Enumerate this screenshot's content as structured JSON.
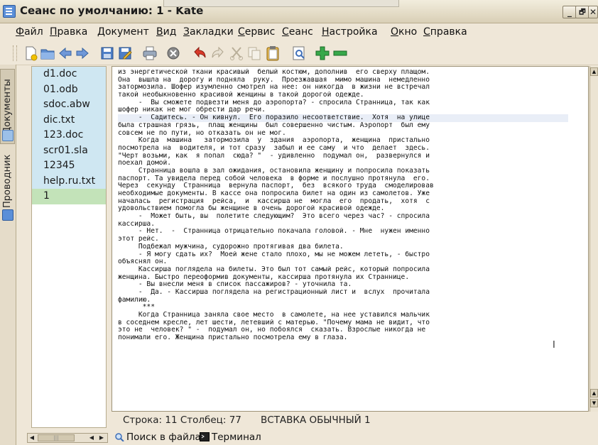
{
  "window": {
    "title": "Сеанс по умолчанию: 1 - Kate",
    "btn_min": "_",
    "btn_max": "🗗",
    "btn_close": "✕"
  },
  "menu": [
    "Файл",
    "Правка",
    "Документ",
    "Вид",
    "Закладки",
    "Сервис",
    "Сеанс",
    "Настройка",
    "Окно",
    "Справка"
  ],
  "toolbar_icons": [
    "new-document-icon",
    "open-folder-icon",
    "back-arrow-icon",
    "forward-arrow-icon",
    "save-disk-icon",
    "save-as-icon",
    "print-icon",
    "close-document-icon",
    "undo-icon",
    "redo-icon",
    "cut-icon",
    "copy-icon",
    "paste-icon",
    "find-icon",
    "zoom-in-icon",
    "zoom-out-icon"
  ],
  "side_tabs": {
    "documents": "Документы",
    "explorer": "Проводник"
  },
  "files": [
    "d1.doc",
    "01.odb",
    "sdoc.abw",
    "dic.txt",
    "123.doc",
    "scr01.sla",
    "12345",
    "help.ru.txt",
    "1"
  ],
  "editor_lines": [
    "из энергетической ткани красивый  белый костюм, дополнив  его сверху плащом.",
    "Она  вышла на  дорогу и подняла  руку.  Проезжавшая  мимо машина  немедленно",
    "затормозила. Шофер изумленно смотрел на нее: он никогда  в жизни не встречал",
    "такой необыкновенно красивой женщины в такой дорогой одежде.",
    "     -  Вы сможете подвезти меня до аэропорта? - спросила Странница, так как",
    "шофер никак не мог обрести дар речи.",
    "     -  Садитесь. - Он кивнул.  Его поразило несоответствие.  Хотя  на улице",
    "была страшная грязь,  плащ женщины  был совершенно чистым. Аэропорт  был ему",
    "совсем не по пути, но отказать он не мог.",
    "     Когда  машина   затормозила  у  здания  аэропорта,  женщина  пристально",
    "посмотрела на  водителя, и тот сразу  забыл и ее саму  и что  делает  здесь.",
    "\"Черт возьми, как  я попал  сюда? \"  - удивленно  подумал он,  развернулся и",
    "поехал домой.",
    "     Странница вошла в зал ожидания, остановила женщину и попросила показать",
    "паспорт. Та увидела перед собой человека  в форме и послушно протянула  его.",
    "Через  секунду  Странница  вернула паспорт,  без  всякого труда  смоделировав",
    "необходимые документы. В кассе она попросила билет на один из самолетов. Уже",
    "началась  регистрация  рейса,  и  кассирша не  могла  его  продать,  хотя  с",
    "удовольствием помогла бы женщине в очень дорогой красивой одежде.",
    "     -  Может быть, вы  полетите следующим?  Это всего через час? - спросила",
    "кассирша.",
    "     - Нет.  -  Странница отрицательно покачала головой. - Мне  нужен именно",
    "этот рейс.",
    "     Подбежал мужчина, судорожно протягивая два билета.",
    "     - Я могу сдать их?  Моей жене стало плохо, мы не можем лететь, - быстро",
    "объяснял он.",
    "     Кассирша поглядела на билеты. Это был тот самый рейс, который попросила",
    "женщина. Быстро переоформив документы, кассирша протянула их Страннице.",
    "     - Вы внесли меня в список пассажиров? - уточнила та.",
    "     -  Да. - Кассирша поглядела на регистрационный лист и  вслух  прочитала",
    "фамилию.",
    "      ***",
    "     Когда Странница заняла свое место  в самолете, на нее уставился мальчик",
    "в соседнем кресле, лет шести, летевший с матерью. \"Почему мама не видит, что",
    "это не  человек? \" -  подумал он, но побоялся  сказать. Взрослые никогда не",
    "понимали его. Женщина пристально посмотрела ему в глаза."
  ],
  "status": {
    "position": "Строка: 11 Столбец: 77",
    "mode": "ВСТАВКА  ОБЫЧНЫЙ  1"
  },
  "bottom_tabs": {
    "find_in_files": "Поиск в файлах",
    "terminal": "Терминал"
  },
  "colors": {
    "file_bg": "#cfe7f2",
    "file_current_bg": "#c3e3b9",
    "window_bg": "#efe7d8"
  }
}
